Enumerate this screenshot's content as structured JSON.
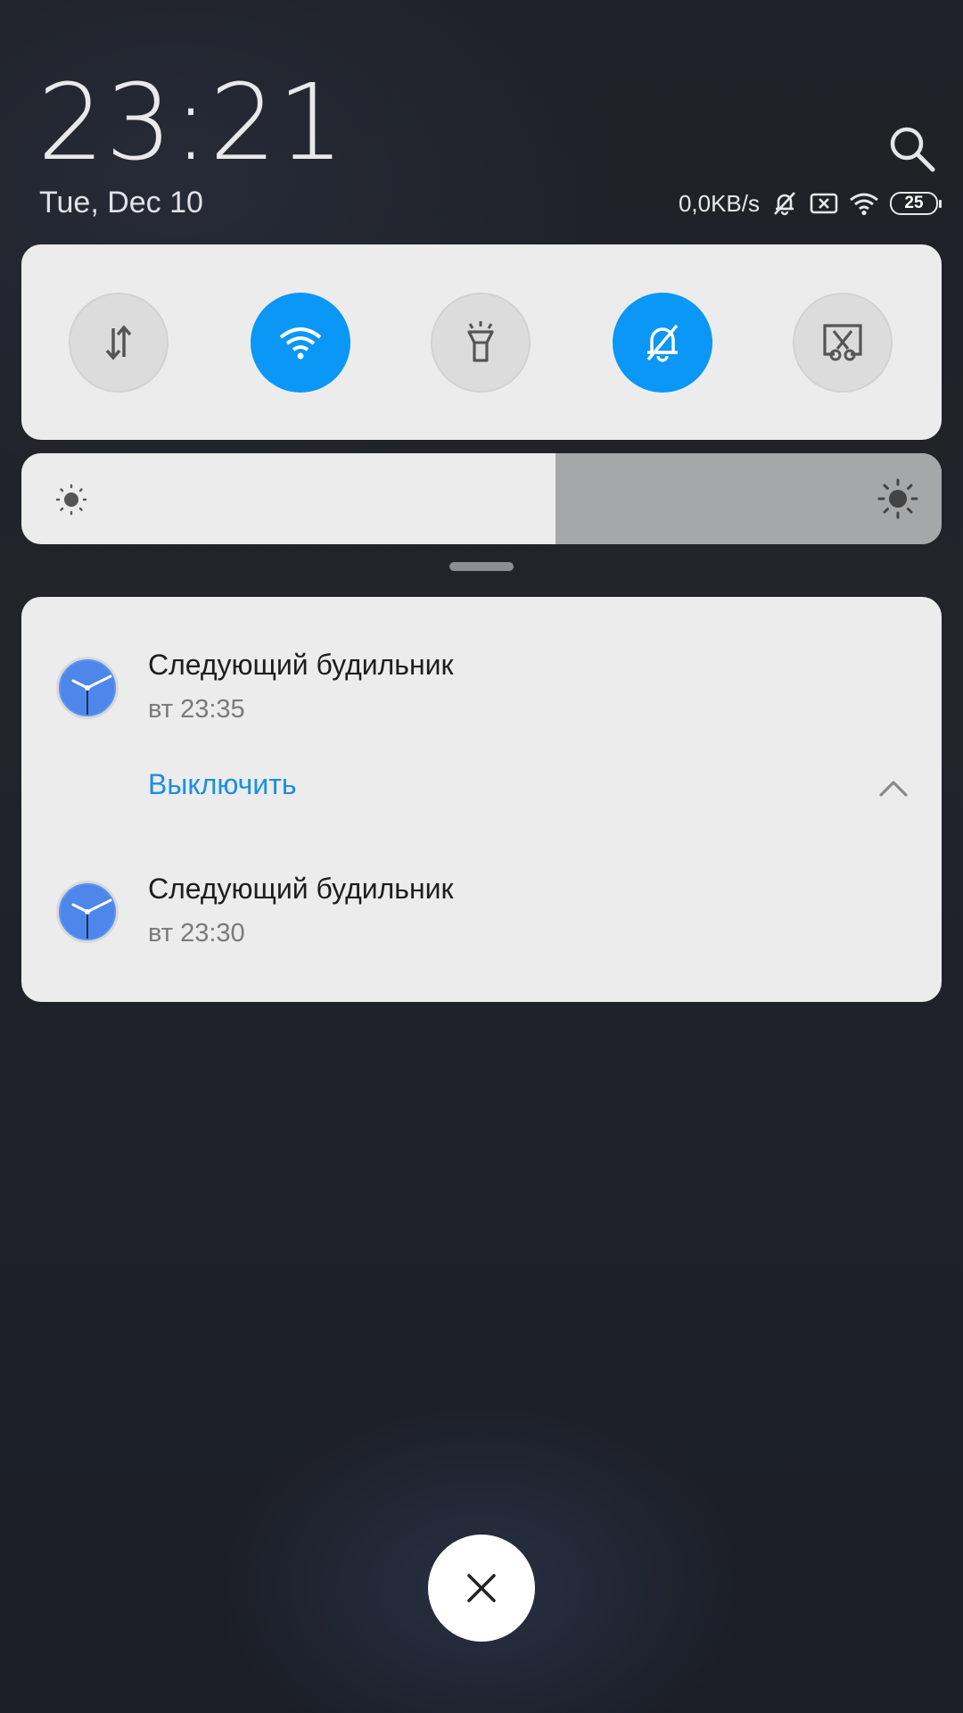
{
  "header": {
    "time": "23:21",
    "date": "Tue, Dec 10"
  },
  "status_bar": {
    "network_speed": "0,0KB/s",
    "battery_level": "25",
    "icons": [
      "mute-icon",
      "no-sim-icon",
      "wifi-icon",
      "battery-icon"
    ]
  },
  "quick_toggles": [
    {
      "name": "mobile-data",
      "icon": "data-arrows-icon",
      "state": "off"
    },
    {
      "name": "wifi",
      "icon": "wifi-icon",
      "state": "on"
    },
    {
      "name": "flashlight",
      "icon": "flashlight-icon",
      "state": "off"
    },
    {
      "name": "silent",
      "icon": "bell-off-icon",
      "state": "on"
    },
    {
      "name": "screenshot",
      "icon": "scissors-icon",
      "state": "off"
    }
  ],
  "brightness": {
    "level": 0.58
  },
  "notifications": [
    {
      "title": "Следующий будильник",
      "subtitle": "вт 23:35",
      "action": "Выключить",
      "expanded": true
    },
    {
      "title": "Следующий будильник",
      "subtitle": "вт 23:30"
    }
  ],
  "colors": {
    "accent": "#0a97f5",
    "action_text": "#1a8fe3",
    "panel": "#ececec"
  }
}
